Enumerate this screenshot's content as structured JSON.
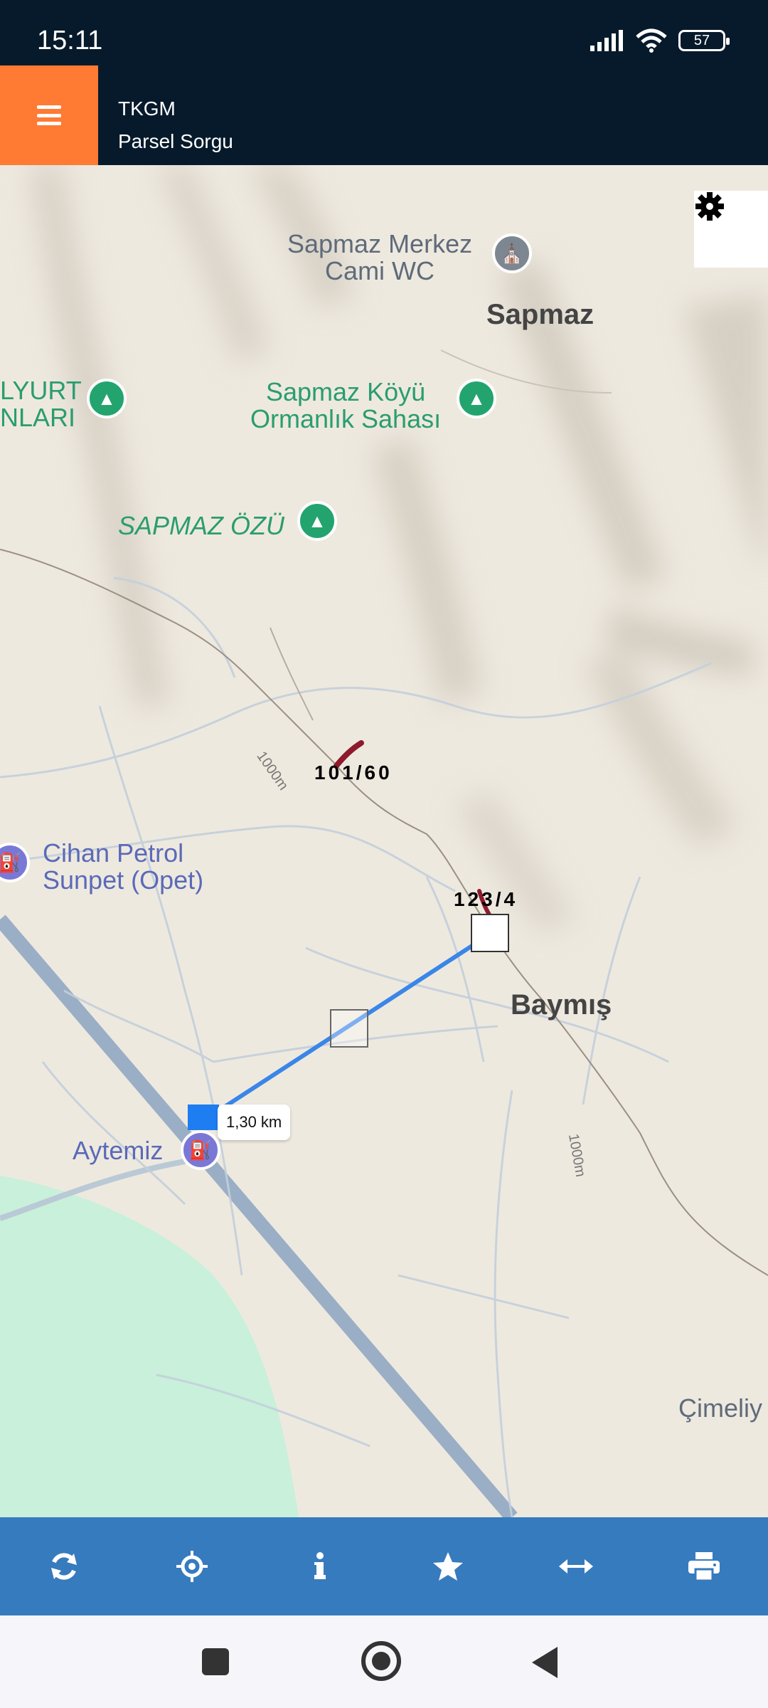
{
  "status_bar": {
    "time": "15:11",
    "battery": "57"
  },
  "header": {
    "title": "TKGM",
    "subtitle": "Parsel Sorgu"
  },
  "map": {
    "labels": {
      "sapmaz_cami": "Sapmaz Merkez\nCami WC",
      "sapmaz": "Sapmaz",
      "lyurt": "LYURT\nNLARI",
      "sapmaz_koyu": "Sapmaz Köyü\nOrmanlık Sahası",
      "sapmaz_ozu": "SAPMAZ ÖZÜ",
      "cihan_petrol": "Cihan Petrol\nSunpet (Opet)",
      "baymis": "Baymış",
      "aytemiz": "Aytemiz",
      "cimeliy": "Çimeliy",
      "contour_1": "1000m",
      "contour_2": "1000m"
    },
    "parcels": {
      "parcel_1": "101/60",
      "parcel_2": "123/4"
    },
    "measurement": {
      "distance": "1,30 km"
    }
  },
  "toolbar": {
    "items": [
      "refresh-icon",
      "locate-icon",
      "info-icon",
      "star-icon",
      "measure-icon",
      "print-icon"
    ]
  },
  "colors": {
    "header_bg": "#071a2c",
    "menu_bg": "#ff7a33",
    "toolbar_bg": "#367bbd",
    "measure_line": "#3a86e8"
  }
}
